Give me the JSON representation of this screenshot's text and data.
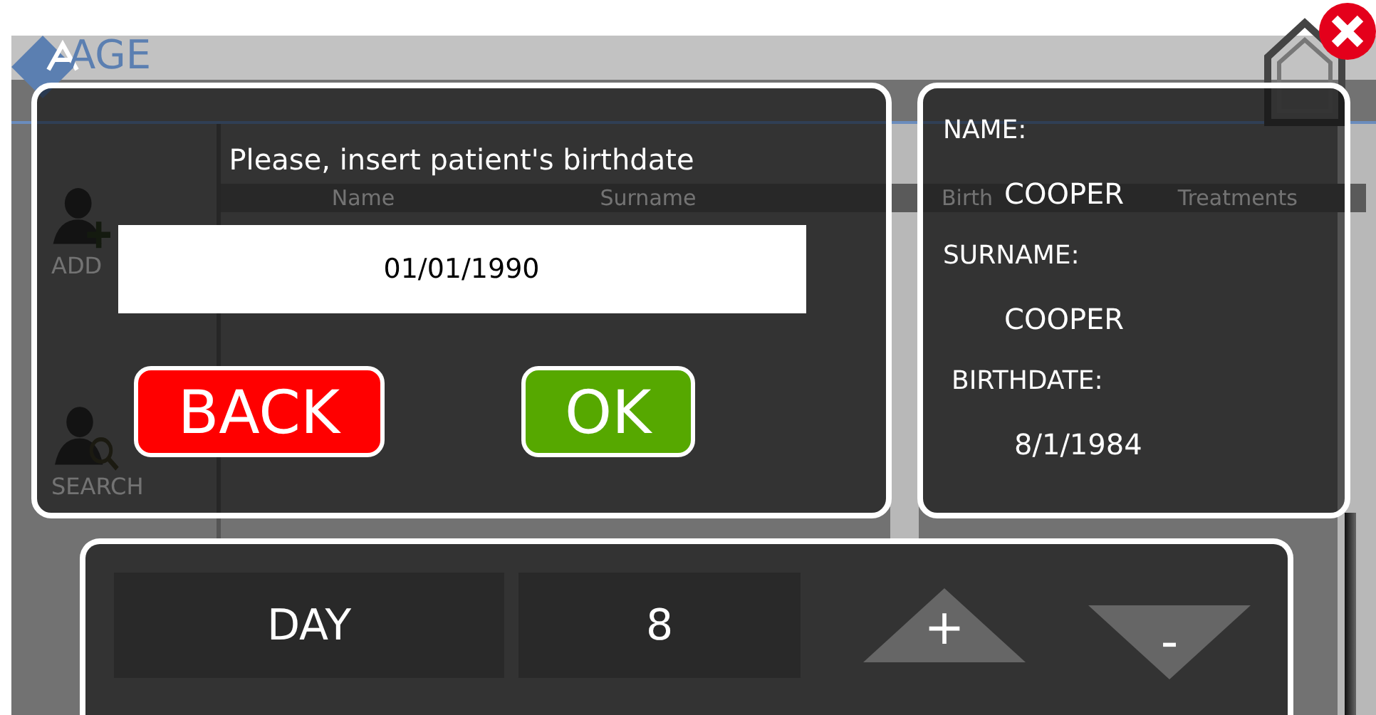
{
  "app": {
    "logo": "AGE",
    "sidebar": [
      {
        "label": "ADD",
        "kind": "add"
      },
      {
        "label": "SEARCH",
        "kind": "search"
      }
    ],
    "table": {
      "columns": [
        "Name",
        "Surname",
        "Birth",
        "Treatments"
      ]
    }
  },
  "date_dialog": {
    "prompt": "Please, insert patient's birthdate",
    "value": "01/01/1990",
    "buttons": [
      {
        "label": "BACK",
        "kind": "back"
      },
      {
        "label": "OK",
        "kind": "ok"
      }
    ]
  },
  "patient": {
    "fields": [
      {
        "label": "NAME:",
        "value": "COOPER"
      },
      {
        "label": "SURNAME:",
        "value": "COOPER"
      },
      {
        "label": "BIRTHDATE:",
        "value": "8/1/1984"
      }
    ]
  },
  "stepper": {
    "field": "DAY",
    "value": "8",
    "increment": "+",
    "decrement": "-"
  }
}
